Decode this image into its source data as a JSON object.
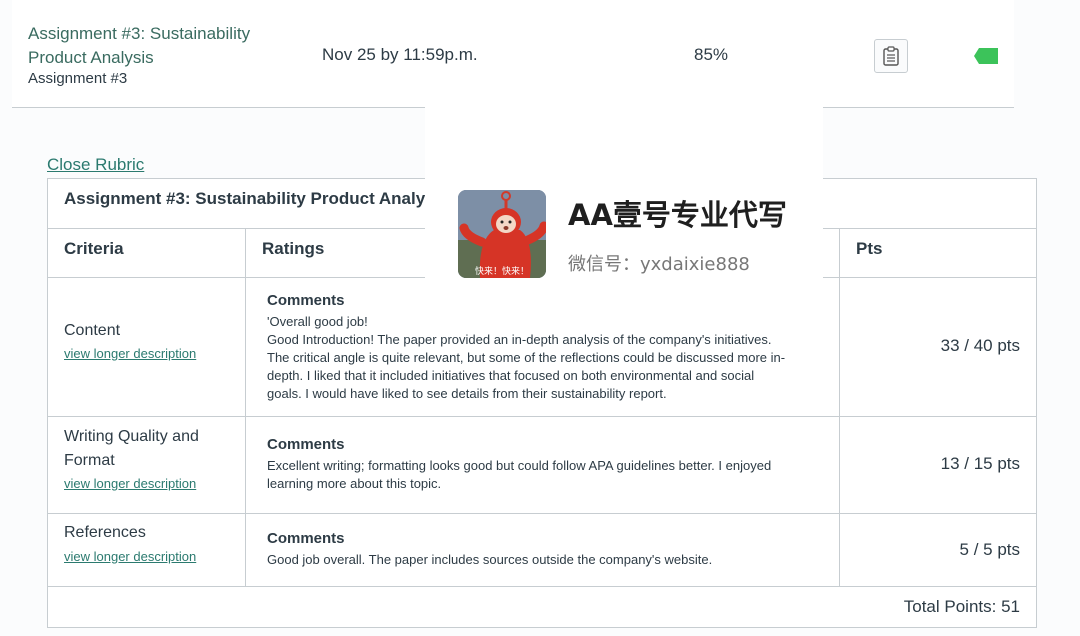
{
  "assignment": {
    "title": "Assignment #3: Sustainability Product Analysis",
    "subtitle": "Assignment #3",
    "due": "Nov 25 by 11:59p.m.",
    "score": "85%",
    "rubric_icon": "clipboard-icon",
    "tag_icon": "tag-icon",
    "tag_color": "#3cc35a"
  },
  "rubric": {
    "close_label": "Close Rubric",
    "title": "Assignment #3: Sustainability Product Analy",
    "headers": {
      "criteria": "Criteria",
      "ratings": "Ratings",
      "pts": "Pts"
    },
    "rows": [
      {
        "name": "Content",
        "link": "view longer description",
        "comment_label": "Comments",
        "comment_lines": [
          "'Overall good job!",
          "Good Introduction! The paper provided an in-depth analysis of the company's initiatives.",
          "The critical angle is quite relevant, but some of the reflections could be discussed more in-",
          "depth. I liked that it included initiatives that focused on both environmental and social",
          "goals. I would have liked to see details from their sustainability report."
        ],
        "points": "33 / 40 pts"
      },
      {
        "name_lines": [
          "Writing Quality and",
          "Format"
        ],
        "link": "view longer description",
        "comment_label": "Comments",
        "comment_lines": [
          "Excellent writing; formatting looks good but could follow APA guidelines better. I enjoyed",
          "learning more about this topic."
        ],
        "points": "13 / 15 pts"
      },
      {
        "name": "References",
        "link": "view longer description",
        "comment_label": "Comments",
        "comment_lines": [
          "Good job overall. The paper includes sources outside the company's website."
        ],
        "points": "5 / 5 pts"
      }
    ],
    "total": "Total Points: 51"
  },
  "overlay": {
    "title": "AA壹号专业代写",
    "subtitle": "微信号：yxdaixie888",
    "avatar_caption": "快来！快来！",
    "avatar_icon": "red-character-avatar-icon"
  }
}
